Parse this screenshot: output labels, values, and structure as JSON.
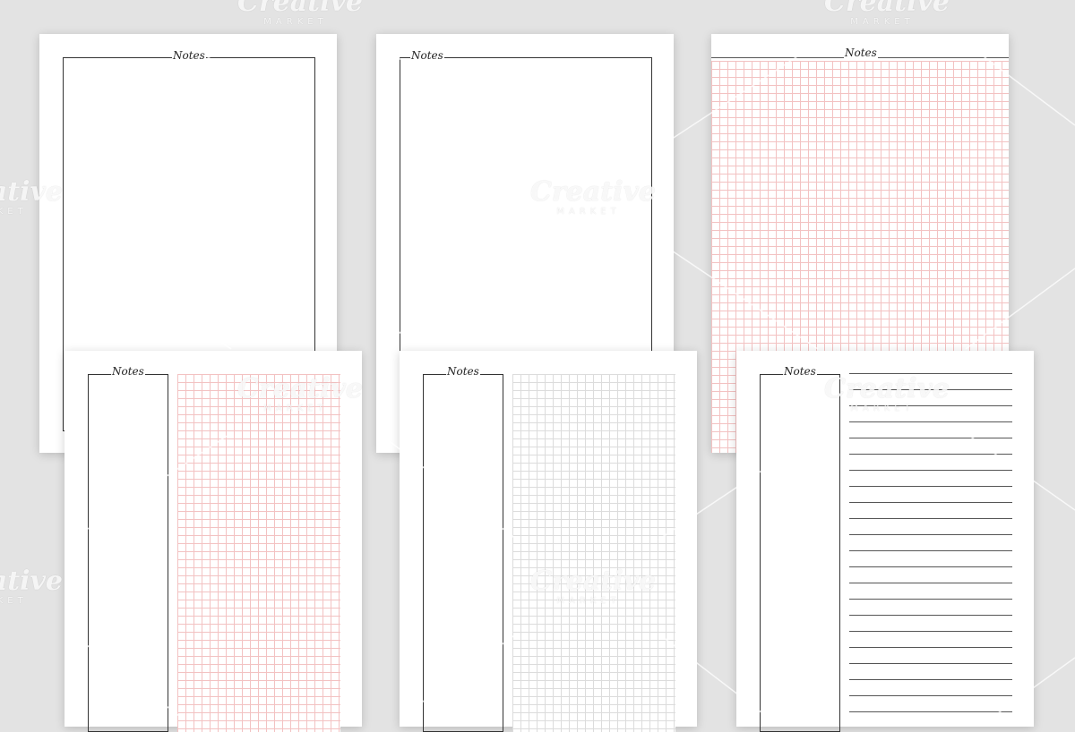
{
  "pages": [
    {
      "title": "Notes",
      "layout": "blank"
    },
    {
      "title": "Notes",
      "layout": "blank"
    },
    {
      "title": "Notes",
      "layout": "grid-pink"
    },
    {
      "title": "Notes",
      "layout": "column-grid-pink"
    },
    {
      "title": "Notes",
      "layout": "column-grid-gray"
    },
    {
      "title": "Notes",
      "layout": "column-lined"
    }
  ],
  "watermark": {
    "title": "Creative",
    "subtitle": "MARKET",
    "color": "#ffffff"
  },
  "colors": {
    "background": "#e3e3e3",
    "paper": "#ffffff",
    "grid_pink": "#f3c2c2",
    "grid_gray": "#dcdcdc",
    "line": "#555555"
  }
}
